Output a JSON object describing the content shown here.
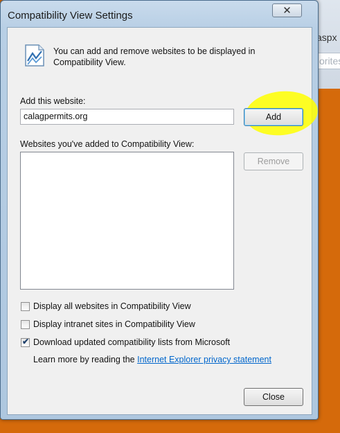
{
  "dialog": {
    "title": "Compatibility View Settings",
    "close_glyph": "✕"
  },
  "info": {
    "text": "You can add and remove websites to be displayed in Compatibility View."
  },
  "add_site": {
    "label": "Add this website:",
    "value": "calagpermits.org",
    "add_button": "Add"
  },
  "list": {
    "label": "Websites you've added to Compatibility View:",
    "items": [],
    "remove_button": "Remove"
  },
  "options": {
    "display_all": {
      "label": "Display all websites in Compatibility View",
      "checked": false
    },
    "display_intranet": {
      "label": "Display intranet sites in Compatibility View",
      "checked": false
    },
    "download_lists": {
      "label": "Download updated compatibility lists from Microsoft",
      "checked": true
    }
  },
  "learn_more": {
    "prefix": "Learn more by reading the",
    "link": "Internet Explorer privacy statement"
  },
  "footer": {
    "close_button": "Close"
  },
  "background": {
    "tab_text": "aspx",
    "search_text": "orites"
  },
  "colors": {
    "desktop": "#d56a0b",
    "highlight": "#ffff00",
    "link": "#0066cc"
  }
}
